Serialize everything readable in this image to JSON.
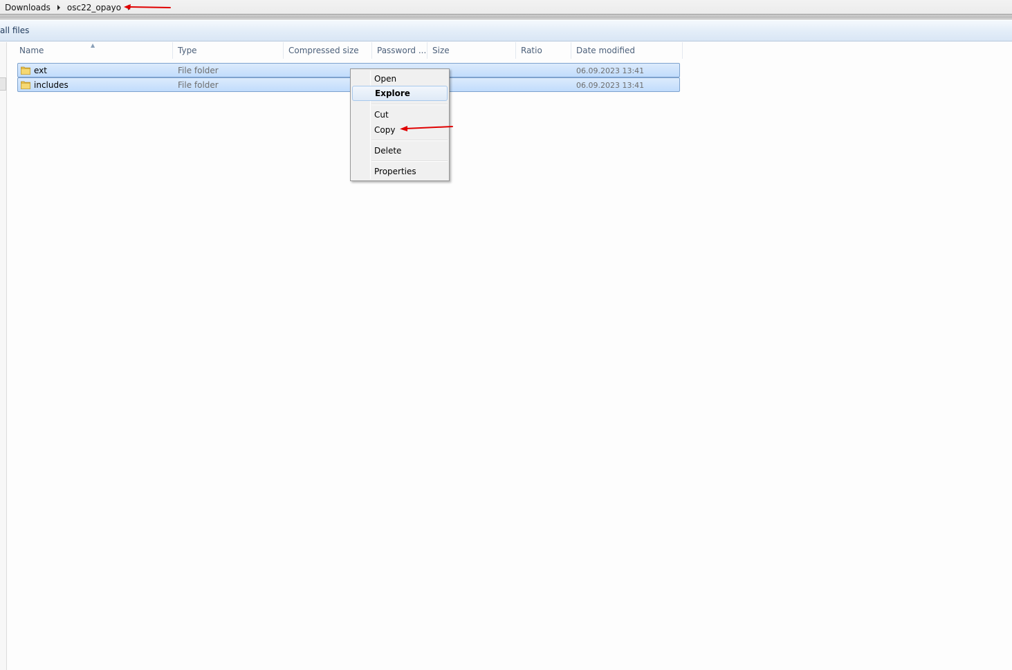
{
  "breadcrumb": {
    "items": [
      "Downloads",
      "osc22_opayo"
    ]
  },
  "commandbar": {
    "label": "all files"
  },
  "columns": [
    "Name",
    "Type",
    "Compressed size",
    "Password ...",
    "Size",
    "Ratio",
    "Date modified"
  ],
  "rows": [
    {
      "name": "ext",
      "type": "File folder",
      "date": "06.09.2023 13:41",
      "icon": "folder-icon"
    },
    {
      "name": "includes",
      "type": "File folder",
      "date": "06.09.2023 13:41",
      "icon": "folder-icon"
    }
  ],
  "context_menu": {
    "items": [
      "Open",
      "Explore",
      "Cut",
      "Copy",
      "Delete",
      "Properties"
    ],
    "highlighted": "Explore"
  },
  "colors": {
    "selection": "#c1dcfc",
    "annotation": "#e00000"
  }
}
